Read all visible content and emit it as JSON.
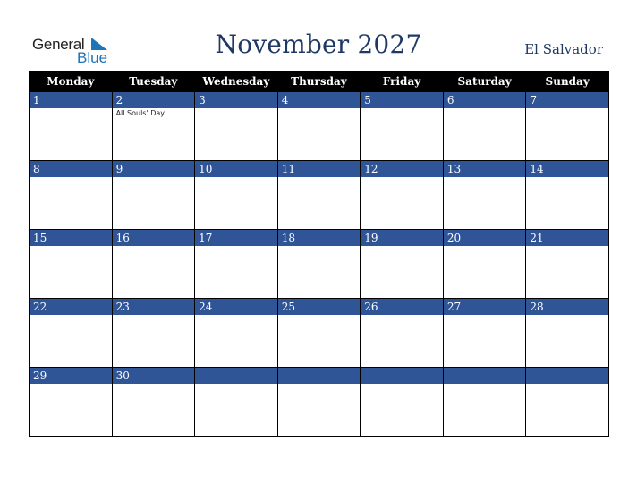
{
  "logo": {
    "line1": "General",
    "line2": "Blue",
    "brand_color": "#1f73b7"
  },
  "header": {
    "title": "November 2027",
    "country": "El Salvador"
  },
  "colors": {
    "title": "#1f3864",
    "day_bar": "#2f5597",
    "header_bg": "#000000"
  },
  "weekdays": [
    "Monday",
    "Tuesday",
    "Wednesday",
    "Thursday",
    "Friday",
    "Saturday",
    "Sunday"
  ],
  "weeks": [
    [
      {
        "day": "1",
        "event": ""
      },
      {
        "day": "2",
        "event": "All Souls' Day"
      },
      {
        "day": "3",
        "event": ""
      },
      {
        "day": "4",
        "event": ""
      },
      {
        "day": "5",
        "event": ""
      },
      {
        "day": "6",
        "event": ""
      },
      {
        "day": "7",
        "event": ""
      }
    ],
    [
      {
        "day": "8",
        "event": ""
      },
      {
        "day": "9",
        "event": ""
      },
      {
        "day": "10",
        "event": ""
      },
      {
        "day": "11",
        "event": ""
      },
      {
        "day": "12",
        "event": ""
      },
      {
        "day": "13",
        "event": ""
      },
      {
        "day": "14",
        "event": ""
      }
    ],
    [
      {
        "day": "15",
        "event": ""
      },
      {
        "day": "16",
        "event": ""
      },
      {
        "day": "17",
        "event": ""
      },
      {
        "day": "18",
        "event": ""
      },
      {
        "day": "19",
        "event": ""
      },
      {
        "day": "20",
        "event": ""
      },
      {
        "day": "21",
        "event": ""
      }
    ],
    [
      {
        "day": "22",
        "event": ""
      },
      {
        "day": "23",
        "event": ""
      },
      {
        "day": "24",
        "event": ""
      },
      {
        "day": "25",
        "event": ""
      },
      {
        "day": "26",
        "event": ""
      },
      {
        "day": "27",
        "event": ""
      },
      {
        "day": "28",
        "event": ""
      }
    ],
    [
      {
        "day": "29",
        "event": ""
      },
      {
        "day": "30",
        "event": ""
      },
      {
        "day": "",
        "event": ""
      },
      {
        "day": "",
        "event": ""
      },
      {
        "day": "",
        "event": ""
      },
      {
        "day": "",
        "event": ""
      },
      {
        "day": "",
        "event": ""
      }
    ]
  ]
}
